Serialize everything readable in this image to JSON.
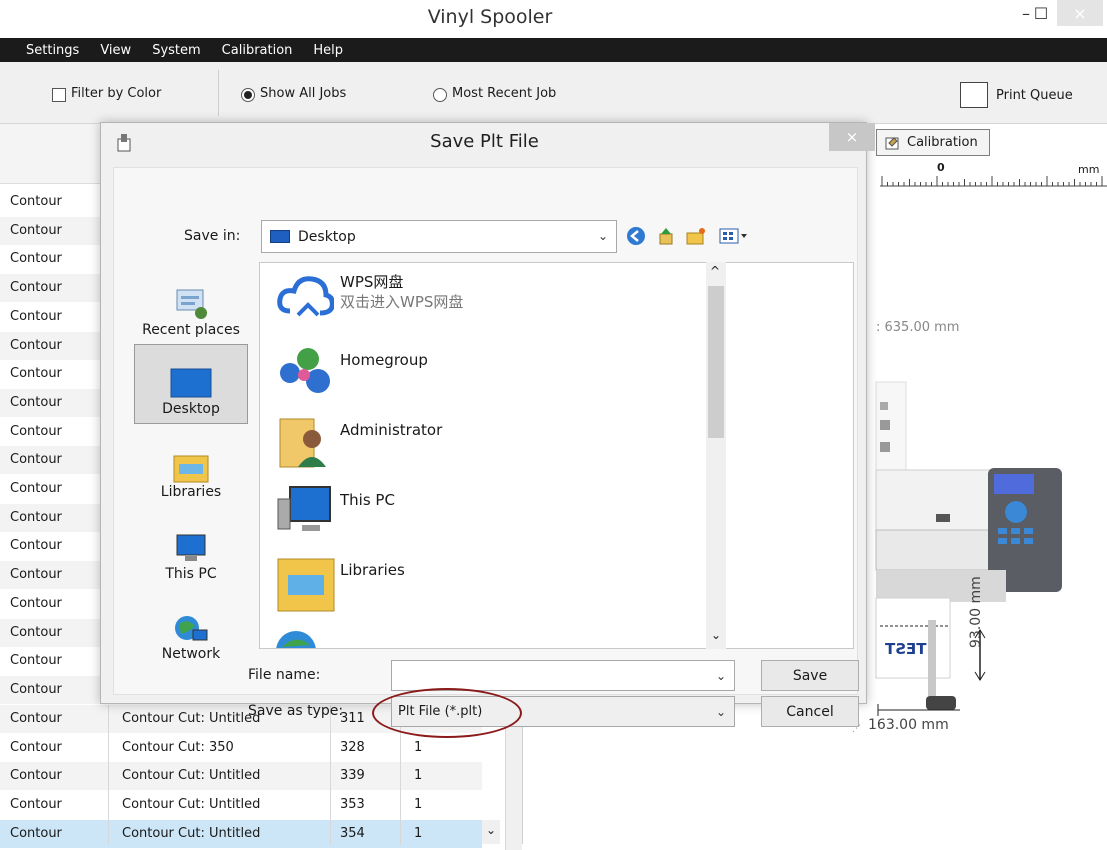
{
  "window": {
    "title": "Vinyl Spooler",
    "minimize_glyph": "–",
    "maximize_glyph": "☐",
    "close_glyph": "×"
  },
  "menu": [
    "Settings",
    "View",
    "System",
    "Calibration",
    "Help"
  ],
  "toolbar": {
    "filter_by_color": "Filter by Color",
    "show_all_jobs": "Show All Jobs",
    "most_recent_job": "Most Recent Job",
    "print_queue": "Print Queue",
    "show_all_selected": true,
    "filter_checked": false
  },
  "job_list": {
    "type_rows": [
      "Contour",
      "Contour",
      "Contour",
      "Contour",
      "Contour",
      "Contour",
      "Contour",
      "Contour",
      "Contour",
      "Contour",
      "Contour",
      "Contour",
      "Contour",
      "Contour",
      "Contour",
      "Contour",
      "Contour",
      "Contour"
    ],
    "full_rows": [
      {
        "type": "Contour",
        "name": "Contour Cut: Untitled",
        "id": "311",
        "qty": "1"
      },
      {
        "type": "Contour",
        "name": "Contour Cut: 350",
        "id": "328",
        "qty": "1"
      },
      {
        "type": "Contour",
        "name": "Contour Cut: Untitled",
        "id": "339",
        "qty": "1"
      },
      {
        "type": "Contour",
        "name": "Contour Cut: Untitled",
        "id": "353",
        "qty": "1"
      },
      {
        "type": "Contour",
        "name": "Contour Cut: Untitled",
        "id": "354",
        "qty": "1"
      }
    ],
    "scroll_down_glyph": "⌄"
  },
  "right_panel": {
    "calibration_tab": "Calibration",
    "ruler_zero": "0",
    "ruler_unit": "mm",
    "width_readout": ": 635.00 mm",
    "dim_width": "163.00 mm",
    "dim_height": "93.00 mm",
    "label_text": "TEST"
  },
  "dialog": {
    "title": "Save Plt File",
    "close_glyph": "×",
    "save_in_label": "Save in:",
    "save_in_value": "Desktop",
    "places": [
      "Recent places",
      "Desktop",
      "Libraries",
      "This PC",
      "Network"
    ],
    "files": [
      {
        "name": "WPS网盘",
        "subtitle": "双击进入WPS网盘"
      },
      {
        "name": "Homegroup",
        "subtitle": ""
      },
      {
        "name": "Administrator",
        "subtitle": ""
      },
      {
        "name": "This PC",
        "subtitle": ""
      },
      {
        "name": "Libraries",
        "subtitle": ""
      }
    ],
    "file_name_label": "File name:",
    "file_name_value": "",
    "save_as_type_label": "Save as type:",
    "save_as_type_value": "Plt File (*.plt)",
    "save_button": "Save",
    "cancel_button": "Cancel",
    "chevron": "⌄",
    "scroll_up": "^",
    "scroll_down": "⌄"
  },
  "colors": {
    "menubar_bg": "#1b1b1b",
    "selected_row": "#cce6f7",
    "highlight_oval": "#8b1a1a",
    "folder_yellow": "#f1c54a",
    "cloud_blue": "#2b6fd6"
  }
}
